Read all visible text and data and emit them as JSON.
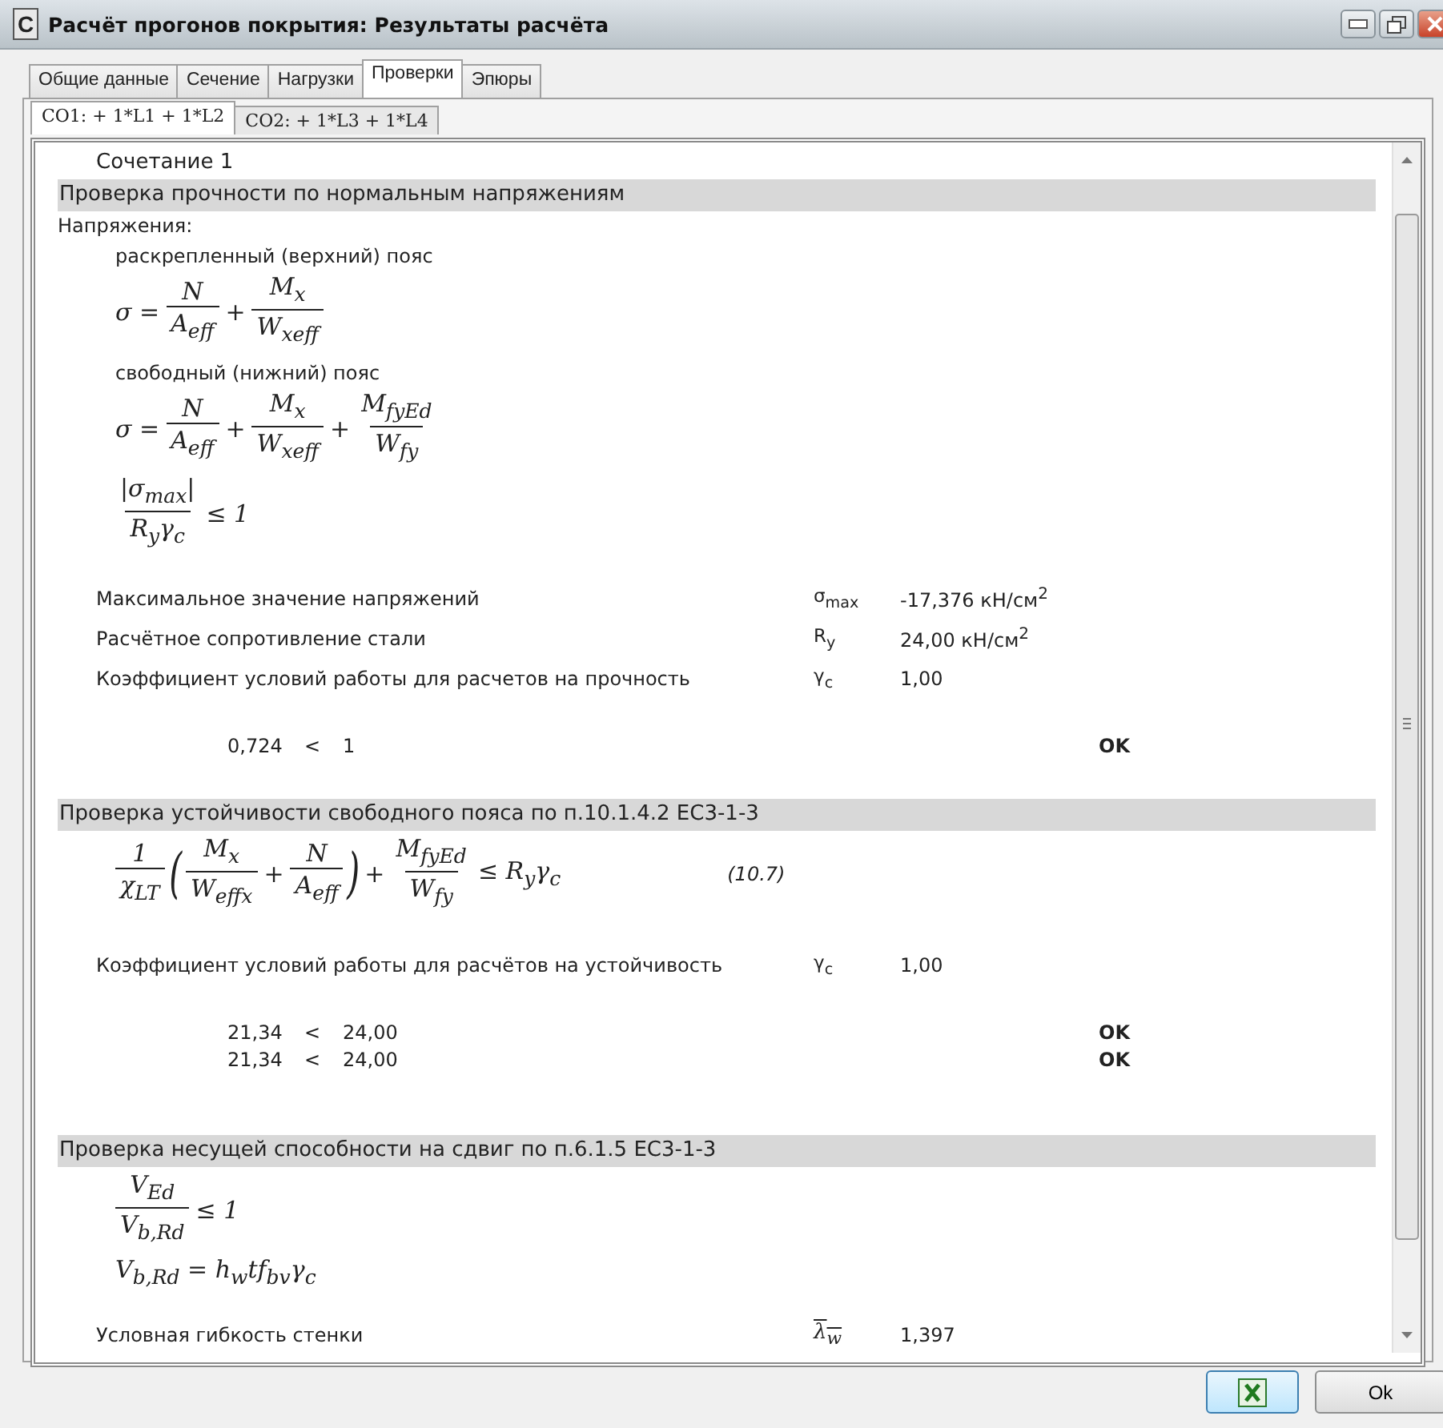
{
  "window": {
    "title": "Расчёт прогонов покрытия:  Результаты расчёта",
    "icon_letter": "C"
  },
  "tabs": [
    {
      "label": "Общие данные",
      "selected": false
    },
    {
      "label": "Сечение",
      "selected": false
    },
    {
      "label": "Нагрузки",
      "selected": false
    },
    {
      "label": "Проверки",
      "selected": true
    },
    {
      "label": "Эпюры",
      "selected": false
    }
  ],
  "subtabs": [
    {
      "label": "СО1:  + 1*L1 + 1*L2",
      "selected": true
    },
    {
      "label": "СО2:  + 1*L3 + 1*L4",
      "selected": false
    }
  ],
  "content": [
    {
      "kind": "caption",
      "text": "Сочетание 1"
    },
    {
      "kind": "header",
      "text": "Проверка прочности по нормальным напряжениям"
    },
    {
      "kind": "label",
      "text": "Напряжения:"
    },
    {
      "kind": "sublabel",
      "text": "раскрепленный (верхний) пояс"
    },
    {
      "kind": "formula",
      "tokens": [
        {
          "kind": "text",
          "s": "σ ="
        },
        {
          "kind": "frac",
          "num": "N",
          "den": "A$_{eff}$"
        },
        {
          "kind": "text",
          "s": "+"
        },
        {
          "kind": "frac",
          "num": "M$_{x}$",
          "den": "W$_{xeff}$"
        }
      ]
    },
    {
      "kind": "sublabel",
      "text": "свободный (нижний) пояс"
    },
    {
      "kind": "formula",
      "tokens": [
        {
          "kind": "text",
          "s": "σ ="
        },
        {
          "kind": "frac",
          "num": "N",
          "den": "A$_{eff}$"
        },
        {
          "kind": "text",
          "s": "+"
        },
        {
          "kind": "frac",
          "num": "M$_{x}$",
          "den": "W$_{xeff}$"
        },
        {
          "kind": "text",
          "s": "+"
        },
        {
          "kind": "frac",
          "num": "M$_{fyEd}$",
          "den": "W$_{fy}$"
        }
      ]
    },
    {
      "kind": "formula",
      "tokens": [
        {
          "kind": "frac",
          "num": "|σ$_{max}$|",
          "den": "R$_{y}$γ$_{c}$"
        },
        {
          "kind": "text",
          "s": "≤ 1"
        }
      ]
    },
    {
      "kind": "param",
      "label": "Максимальное значение напряжений",
      "symbol": "σ$_{max}$",
      "value": "-17,376 кН/см$^{2}$"
    },
    {
      "kind": "param",
      "label": "Расчётное сопротивление стали",
      "symbol": "R$_{y}$",
      "value": "24,00 кН/см$^{2}$"
    },
    {
      "kind": "param",
      "label": "Коэффициент условий работы для расчетов на прочность",
      "symbol": "γ$_{c}$",
      "value": "1,00"
    },
    {
      "kind": "result",
      "value": "0,724",
      "op": "<",
      "limit": "1",
      "status": "OK"
    },
    {
      "kind": "header",
      "text": "Проверка устойчивости свободного пояса по п.10.1.4.2  EC3-1-3"
    },
    {
      "kind": "formula",
      "number": "(10.7)",
      "tokens": [
        {
          "kind": "frac",
          "num": "1",
          "den": "χ$_{LT}$"
        },
        {
          "kind": "paren",
          "s": "("
        },
        {
          "kind": "frac",
          "num": "M$_{x}$",
          "den": "W$_{effx}$"
        },
        {
          "kind": "text",
          "s": "+"
        },
        {
          "kind": "frac",
          "num": "N",
          "den": "A$_{eff}$"
        },
        {
          "kind": "paren",
          "s": ")"
        },
        {
          "kind": "text",
          "s": "+"
        },
        {
          "kind": "frac",
          "num": "M$_{fyEd}$",
          "den": "W$_{fy}$"
        },
        {
          "kind": "text",
          "s": "≤ R$_{y}$γ$_{c}$"
        }
      ]
    },
    {
      "kind": "param",
      "label": "Коэффициент условий работы для расчётов на устойчивость",
      "symbol": "γ$_{c}$",
      "value": "1,00"
    },
    {
      "kind": "result",
      "value": "21,34",
      "op": "<",
      "limit": "24,00",
      "status": "OK"
    },
    {
      "kind": "result",
      "value": "21,34",
      "op": "<",
      "limit": "24,00",
      "status": "OK"
    },
    {
      "kind": "header",
      "text": "Проверка несущей способности на сдвиг по п.6.1.5  EC3-1-3"
    },
    {
      "kind": "formula",
      "tokens": [
        {
          "kind": "frac",
          "num": "V$_{Ed}$",
          "den": "V$_{b,Rd}$"
        },
        {
          "kind": "text",
          "s": "≤ 1"
        }
      ]
    },
    {
      "kind": "formula",
      "tokens": [
        {
          "kind": "text",
          "s": "V$_{b,Rd}$  = h$_{w}$tf$_{bv}$γ$_{c}$"
        }
      ]
    },
    {
      "kind": "param",
      "label": "Условная гибкость стенки",
      "symbol": "λ$_{w}$",
      "overline": true,
      "value": "1,397"
    }
  ],
  "buttons": [
    {
      "kind": "export"
    },
    {
      "kind": "text",
      "label": "Ok"
    }
  ]
}
